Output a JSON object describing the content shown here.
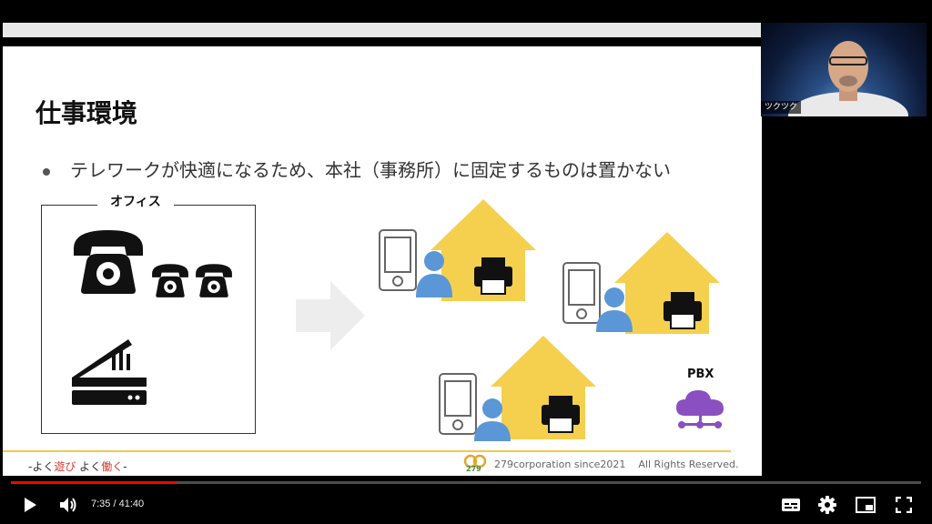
{
  "slide": {
    "title": "仕事環境",
    "bullet": "テレワークが快適になるため、本社（事務所）に固定するものは置かない",
    "office_label": "オフィス",
    "pbx_label": "PBX",
    "footer_left_prefix": "-よく",
    "footer_left_play": "遊び",
    "footer_left_mid": " よく",
    "footer_left_work": "働く",
    "footer_left_suffix": "-",
    "logo_text": "279",
    "footer_company": "279corporation since2021",
    "footer_rights": "All Rights Reserved."
  },
  "webcam": {
    "name": "ツクツク"
  },
  "player": {
    "current_time": "7:35",
    "separator": " / ",
    "duration": "41:40",
    "progress_fraction": 0.182
  },
  "icons": {
    "play": "play-icon",
    "volume": "volume-icon",
    "subtitles": "subtitles-icon",
    "settings": "gear-icon",
    "miniplayer": "miniplayer-icon",
    "fullscreen": "fullscreen-icon"
  },
  "colors": {
    "house": "#f5d04f",
    "person": "#5b97d6",
    "cloud": "#8a4fc0",
    "progress": "#ff0000",
    "footer_line": "#f1c84b"
  }
}
